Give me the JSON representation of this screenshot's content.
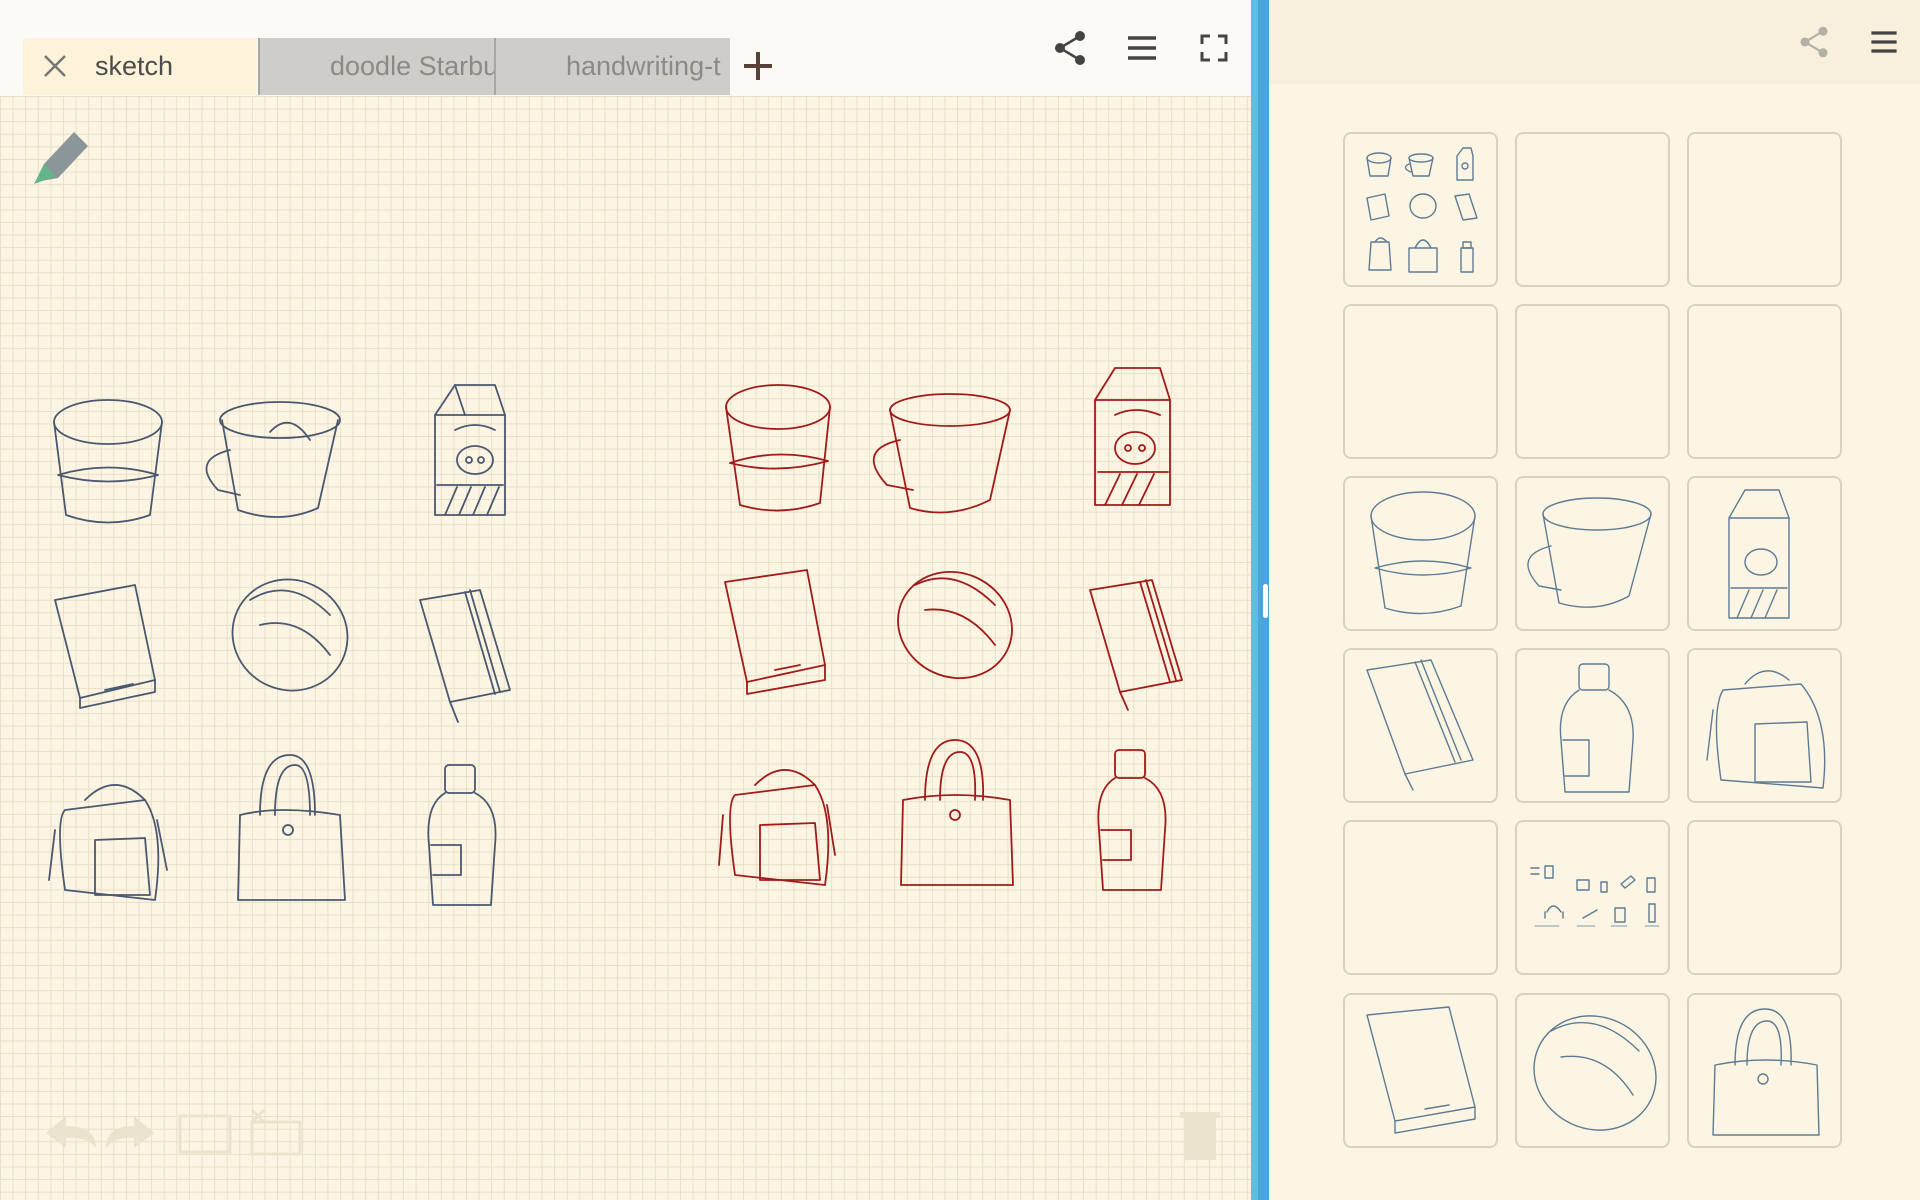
{
  "tabs": [
    {
      "label": "sketch",
      "active": true
    },
    {
      "label": "doodle Starbu",
      "active": false
    },
    {
      "label": "handwriting-t",
      "active": false
    }
  ],
  "toolbar": {
    "add_tab_icon": "plus-icon",
    "share_icon": "share-icon",
    "menu_icon": "menu-icon",
    "fullscreen_icon": "fullscreen-icon",
    "pen_icon": "pencil-icon"
  },
  "canvas": {
    "blue_sketches": [
      "cup",
      "mug",
      "milk-carton",
      "book",
      "mouse",
      "notebook",
      "backpack",
      "handbag",
      "bottle"
    ],
    "red_sketches": [
      "cup",
      "mug",
      "milk-carton",
      "book",
      "mouse",
      "notebook",
      "backpack",
      "handbag",
      "bottle"
    ]
  },
  "bottom_tools": [
    "undo-icon",
    "redo-icon",
    "select-rect-icon",
    "clear-rect-icon",
    "trash-icon"
  ],
  "panel": {
    "share_icon": "share-icon",
    "menu_icon": "menu-icon",
    "thumbnails": [
      "grid-overview",
      "empty",
      "empty",
      "empty",
      "empty",
      "empty",
      "cup",
      "mug",
      "milk-carton",
      "notebook",
      "bottle",
      "backpack",
      "empty",
      "icon-collection",
      "empty",
      "book",
      "mouse",
      "handbag"
    ]
  },
  "colors": {
    "accent": "#5cbde8",
    "paper": "#fcf5e3",
    "blue_ink": "#4a5870",
    "red_ink": "#a11b1b"
  }
}
